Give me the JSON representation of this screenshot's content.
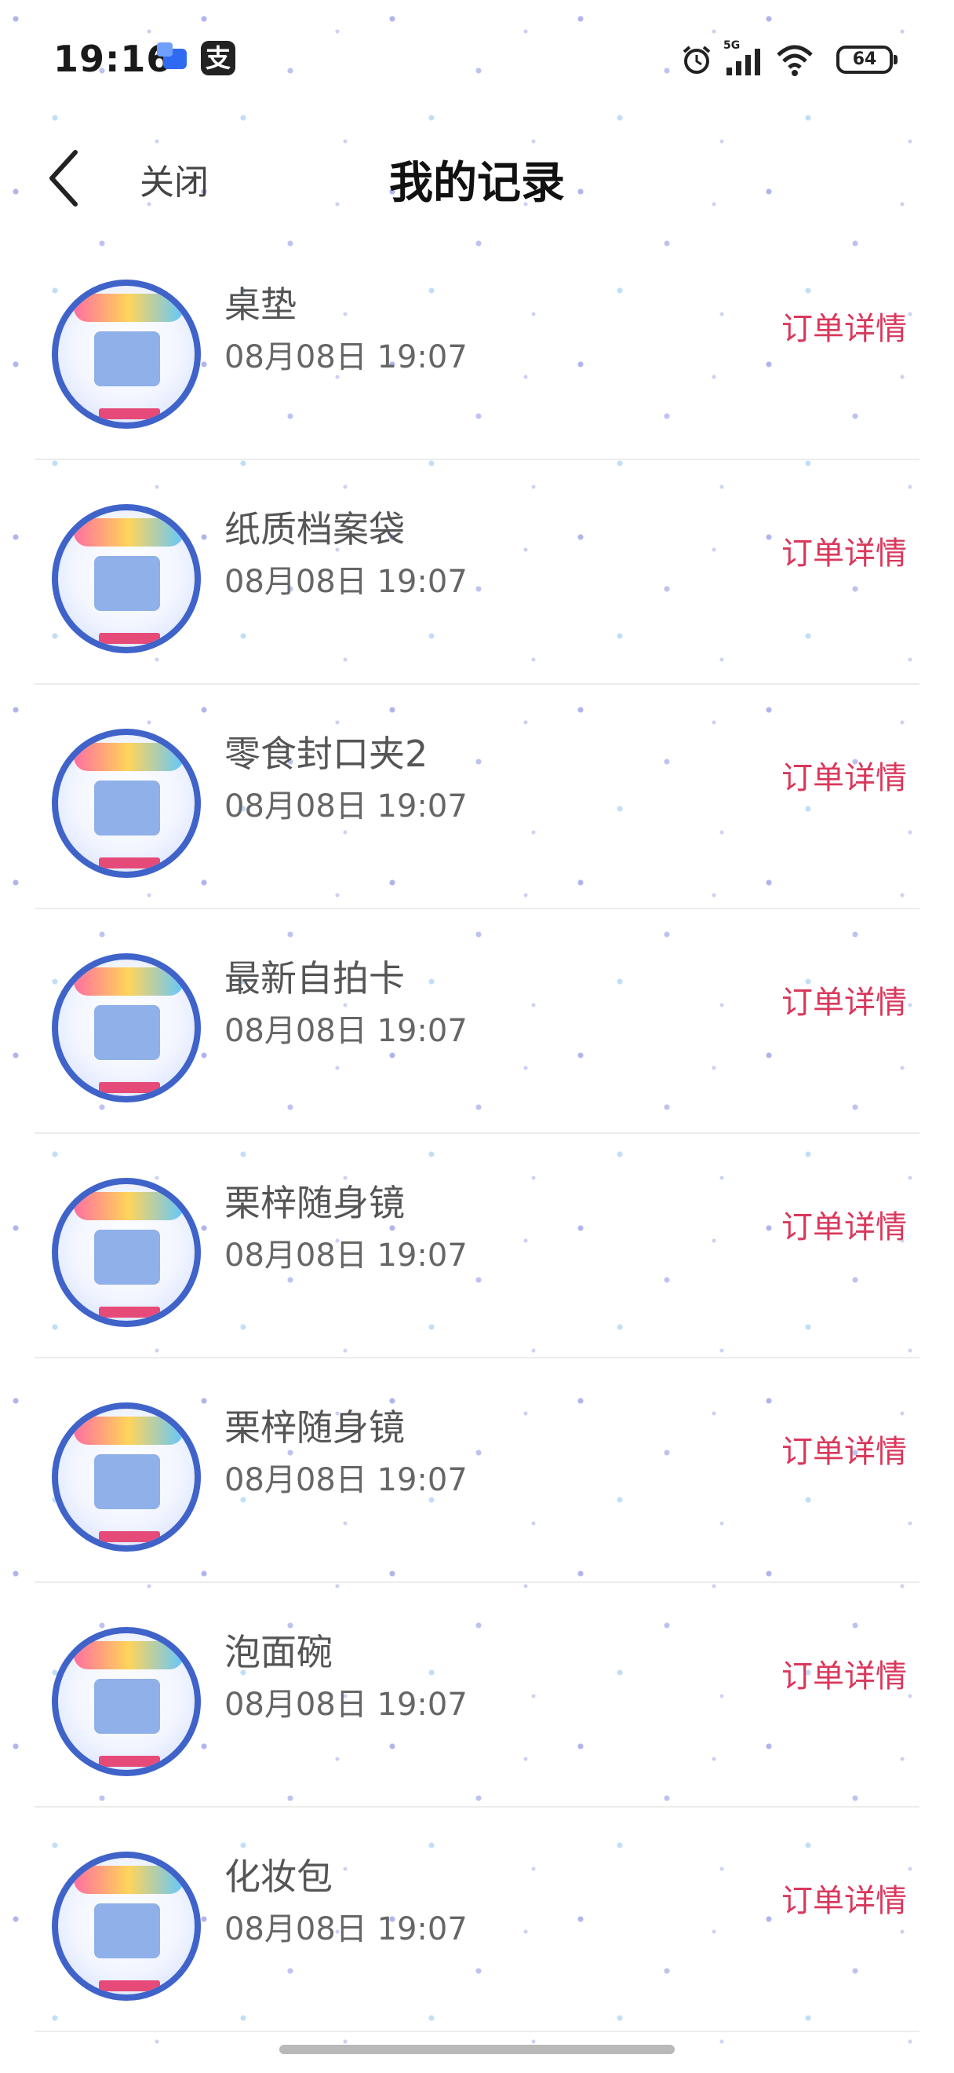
{
  "status_bar": {
    "time": "19:16",
    "app_badge": "支",
    "network": "5G",
    "battery": "64"
  },
  "nav": {
    "close_label": "关闭",
    "title": "我的记录"
  },
  "records": [
    {
      "name": "桌垫",
      "time": "08月08日 19:07",
      "action": "订单详情"
    },
    {
      "name": "纸质档案袋",
      "time": "08月08日 19:07",
      "action": "订单详情"
    },
    {
      "name": "零食封口夹2",
      "time": "08月08日 19:07",
      "action": "订单详情"
    },
    {
      "name": "最新自拍卡",
      "time": "08月08日 19:07",
      "action": "订单详情"
    },
    {
      "name": "栗梓随身镜",
      "time": "08月08日 19:07",
      "action": "订单详情"
    },
    {
      "name": "栗梓随身镜",
      "time": "08月08日 19:07",
      "action": "订单详情"
    },
    {
      "name": "泡面碗",
      "time": "08月08日 19:07",
      "action": "订单详情"
    },
    {
      "name": "化妆包",
      "time": "08月08日 19:07",
      "action": "订单详情"
    }
  ],
  "colors": {
    "accent_link": "#d9385c",
    "thumb_border": "#3f63c9"
  }
}
